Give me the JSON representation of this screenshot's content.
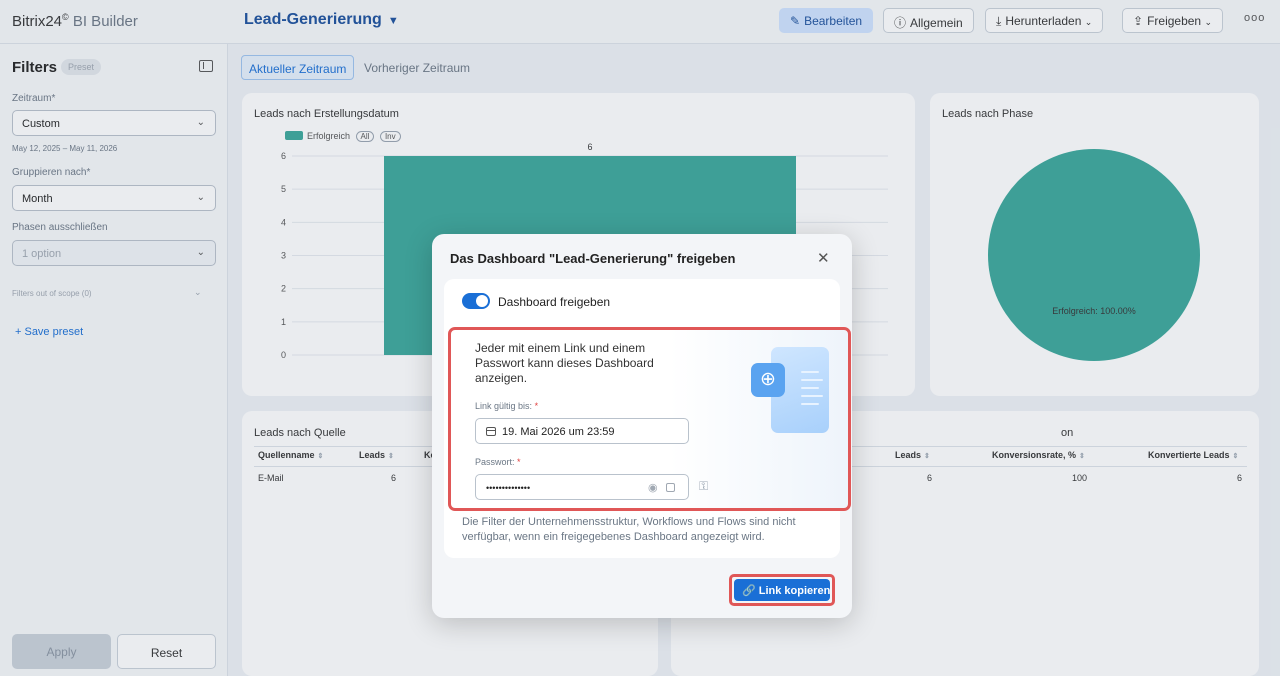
{
  "app": {
    "brand": "Bitrix24",
    "brand_mark": "©",
    "product": "BI Builder"
  },
  "header": {
    "dashboard_title": "Lead-Generierung",
    "buttons": {
      "edit": "Bearbeiten",
      "general": "Allgemein",
      "download": "Herunterladen",
      "share": "Freigeben"
    }
  },
  "sidebar": {
    "title": "Filters",
    "preset_badge": "Preset",
    "period_label": "Zeitraum*",
    "period_value": "Custom",
    "date_range": "May 12, 2025 – May 11, 2026",
    "group_label": "Gruppieren nach*",
    "group_value": "Month",
    "exclude_label": "Phasen ausschließen",
    "exclude_value": "1 option",
    "scope_text": "Filters out of scope (0)",
    "save_preset": "+ Save preset",
    "apply": "Apply",
    "reset": "Reset"
  },
  "tabs": {
    "current": "Aktueller Zeitraum",
    "previous": "Vorheriger Zeitraum"
  },
  "chart_data": [
    {
      "type": "bar",
      "title": "Leads nach Erstellungsdatum",
      "categories": [
        ""
      ],
      "series": [
        {
          "name": "Erfolgreich",
          "values": [
            6
          ]
        }
      ],
      "ylim": [
        0,
        6
      ],
      "yticks": [
        "0",
        "1",
        "2",
        "3",
        "4",
        "5",
        "6"
      ],
      "data_labels": [
        "6"
      ],
      "legend_pills": [
        "All",
        "Inv"
      ],
      "legend": "top-left",
      "color": "#3aa79a"
    },
    {
      "type": "pie",
      "title": "Leads nach Phase",
      "categories": [
        "Erfolgreich"
      ],
      "values": [
        100
      ],
      "slice_label": "Erfolgreich: 100.00%",
      "color": "#3aa79a"
    }
  ],
  "table_source": {
    "title": "Leads nach Quelle",
    "columns": [
      "Quellenname",
      "Leads",
      "Ko"
    ],
    "rows": [
      [
        "E-Mail",
        "6"
      ]
    ]
  },
  "table_conversion": {
    "title_fragment": "on",
    "columns": [
      "Leads",
      "Konversionsrate, %",
      "Konvertierte Leads"
    ],
    "rows": [
      [
        "6",
        "100",
        "6"
      ]
    ]
  },
  "modal": {
    "title": "Das Dashboard \"Lead-Generierung\" freigeben",
    "toggle_label": "Dashboard freigeben",
    "toggle_on": true,
    "info": "Jeder mit einem Link und einem Passwort kann dieses Dashboard anzeigen.",
    "valid_label": "Link gültig bis:",
    "valid_value": "19. Mai 2026 um 23:59",
    "password_label": "Passwort:",
    "password_value": "••••••••••••••",
    "required_mark": "*",
    "note": "Die Filter der Unternehmensstruktur, Workflows und Flows sind nicht verfügbar, wenn ein freigegebenes Dashboard angezeigt wird.",
    "copy_button": "Link kopieren"
  },
  "colors": {
    "accent": "#1a6fd6",
    "highlight": "#e05757",
    "series": "#3aa79a"
  }
}
